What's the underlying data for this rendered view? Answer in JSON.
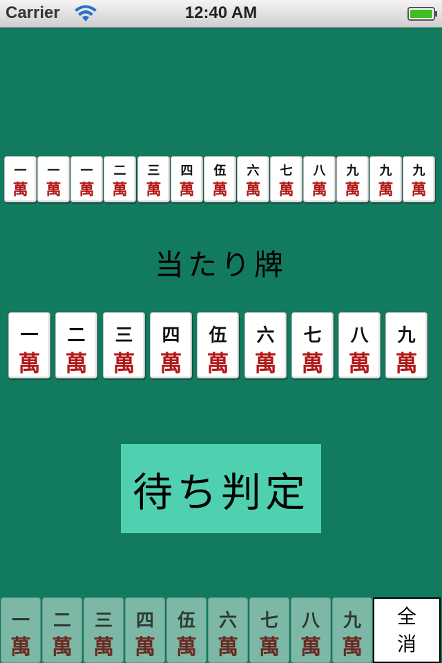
{
  "status_bar": {
    "carrier": "Carrier",
    "time": "12:40 AM",
    "wifi_icon": "wifi-icon",
    "battery_icon": "battery-full-icon"
  },
  "hand": {
    "tiles": [
      {
        "num": "一",
        "suit": "萬"
      },
      {
        "num": "一",
        "suit": "萬"
      },
      {
        "num": "一",
        "suit": "萬"
      },
      {
        "num": "二",
        "suit": "萬"
      },
      {
        "num": "三",
        "suit": "萬"
      },
      {
        "num": "四",
        "suit": "萬"
      },
      {
        "num": "伍",
        "suit": "萬"
      },
      {
        "num": "六",
        "suit": "萬"
      },
      {
        "num": "七",
        "suit": "萬"
      },
      {
        "num": "八",
        "suit": "萬"
      },
      {
        "num": "九",
        "suit": "萬"
      },
      {
        "num": "九",
        "suit": "萬"
      },
      {
        "num": "九",
        "suit": "萬"
      }
    ]
  },
  "winning": {
    "title": "当たり牌",
    "tiles": [
      {
        "num": "一",
        "suit": "萬"
      },
      {
        "num": "二",
        "suit": "萬"
      },
      {
        "num": "三",
        "suit": "萬"
      },
      {
        "num": "四",
        "suit": "萬"
      },
      {
        "num": "伍",
        "suit": "萬"
      },
      {
        "num": "六",
        "suit": "萬"
      },
      {
        "num": "七",
        "suit": "萬"
      },
      {
        "num": "八",
        "suit": "萬"
      },
      {
        "num": "九",
        "suit": "萬"
      }
    ]
  },
  "judge_button": {
    "label": "待ち判定"
  },
  "palette": {
    "tiles": [
      {
        "num": "一",
        "suit": "萬"
      },
      {
        "num": "二",
        "suit": "萬"
      },
      {
        "num": "三",
        "suit": "萬"
      },
      {
        "num": "四",
        "suit": "萬"
      },
      {
        "num": "伍",
        "suit": "萬"
      },
      {
        "num": "六",
        "suit": "萬"
      },
      {
        "num": "七",
        "suit": "萬"
      },
      {
        "num": "八",
        "suit": "萬"
      },
      {
        "num": "九",
        "suit": "萬"
      }
    ],
    "clear_label_line1": "全",
    "clear_label_line2": "消"
  },
  "colors": {
    "table_green": "#127a5e",
    "button_mint": "#4fd1b1",
    "tile_red": "#b31818"
  }
}
